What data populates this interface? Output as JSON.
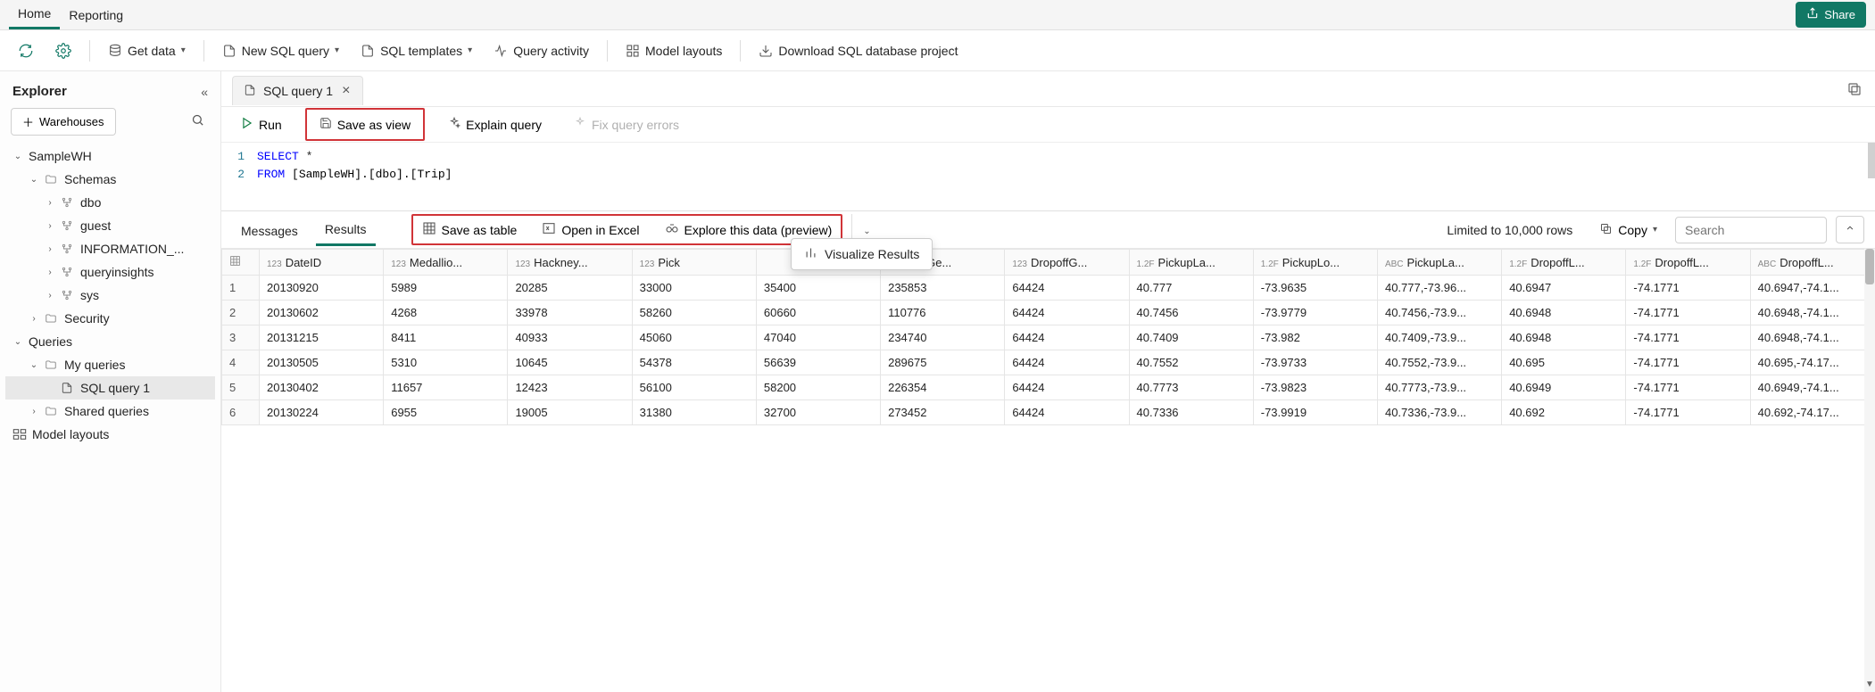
{
  "nav": {
    "home": "Home",
    "reporting": "Reporting",
    "share": "Share"
  },
  "toolbar": {
    "get_data": "Get data",
    "new_sql": "New SQL query",
    "sql_templates": "SQL templates",
    "query_activity": "Query activity",
    "model_layouts": "Model layouts",
    "download": "Download SQL database project"
  },
  "explorer": {
    "title": "Explorer",
    "warehouses": "Warehouses",
    "tree": {
      "samplewh": "SampleWH",
      "schemas": "Schemas",
      "dbo": "dbo",
      "guest": "guest",
      "info": "INFORMATION_...",
      "qi": "queryinsights",
      "sys": "sys",
      "security": "Security",
      "queries": "Queries",
      "my_queries": "My queries",
      "sql_query_1": "SQL query 1",
      "shared_queries": "Shared queries",
      "model_layouts": "Model layouts"
    }
  },
  "tabs": {
    "sql_query_1": "SQL query 1"
  },
  "qbar": {
    "run": "Run",
    "save_as_view": "Save as view",
    "explain": "Explain query",
    "fix": "Fix query errors"
  },
  "editor": {
    "line1_a": "SELECT",
    "line1_b": " *",
    "line2_a": "FROM",
    "line2_b": " [SampleWH].[dbo].[Trip]"
  },
  "results": {
    "messages": "Messages",
    "results_tab": "Results",
    "save_table": "Save as table",
    "open_excel": "Open in Excel",
    "explore": "Explore this data (preview)",
    "visualize": "Visualize Results",
    "limited": "Limited to 10,000 rows",
    "copy": "Copy",
    "search_placeholder": "Search"
  },
  "columns": [
    {
      "type": "123",
      "label": "DateID"
    },
    {
      "type": "123",
      "label": "Medallio..."
    },
    {
      "type": "123",
      "label": "Hackney..."
    },
    {
      "type": "123",
      "label": "Pick"
    },
    {
      "type": "",
      "label": ""
    },
    {
      "type": "",
      "label": "PickupGe..."
    },
    {
      "type": "123",
      "label": "DropoffG..."
    },
    {
      "type": "1.2F",
      "label": "PickupLa..."
    },
    {
      "type": "1.2F",
      "label": "PickupLo..."
    },
    {
      "type": "ABC",
      "label": "PickupLa..."
    },
    {
      "type": "1.2F",
      "label": "DropoffL..."
    },
    {
      "type": "1.2F",
      "label": "DropoffL..."
    },
    {
      "type": "ABC",
      "label": "DropoffL..."
    }
  ],
  "rows": [
    [
      "1",
      "20130920",
      "5989",
      "20285",
      "33000",
      "35400",
      "235853",
      "64424",
      "40.777",
      "-73.9635",
      "40.777,-73.96...",
      "40.6947",
      "-74.1771",
      "40.6947,-74.1..."
    ],
    [
      "2",
      "20130602",
      "4268",
      "33978",
      "58260",
      "60660",
      "110776",
      "64424",
      "40.7456",
      "-73.9779",
      "40.7456,-73.9...",
      "40.6948",
      "-74.1771",
      "40.6948,-74.1..."
    ],
    [
      "3",
      "20131215",
      "8411",
      "40933",
      "45060",
      "47040",
      "234740",
      "64424",
      "40.7409",
      "-73.982",
      "40.7409,-73.9...",
      "40.6948",
      "-74.1771",
      "40.6948,-74.1..."
    ],
    [
      "4",
      "20130505",
      "5310",
      "10645",
      "54378",
      "56639",
      "289675",
      "64424",
      "40.7552",
      "-73.9733",
      "40.7552,-73.9...",
      "40.695",
      "-74.1771",
      "40.695,-74.17..."
    ],
    [
      "5",
      "20130402",
      "11657",
      "12423",
      "56100",
      "58200",
      "226354",
      "64424",
      "40.7773",
      "-73.9823",
      "40.7773,-73.9...",
      "40.6949",
      "-74.1771",
      "40.6949,-74.1..."
    ],
    [
      "6",
      "20130224",
      "6955",
      "19005",
      "31380",
      "32700",
      "273452",
      "64424",
      "40.7336",
      "-73.9919",
      "40.7336,-73.9...",
      "40.692",
      "-74.1771",
      "40.692,-74.17..."
    ]
  ]
}
